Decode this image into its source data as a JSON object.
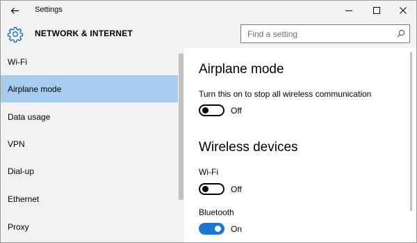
{
  "window": {
    "title": "Settings",
    "controls": [
      "minimize-icon",
      "maximize-icon",
      "close-icon"
    ]
  },
  "header": {
    "section_title": "NETWORK & INTERNET",
    "search_placeholder": "Find a setting",
    "section_icon": "gear-icon",
    "search_icon": "search-icon"
  },
  "sidebar": {
    "items": [
      {
        "label": "Wi-Fi"
      },
      {
        "label": "Airplane mode"
      },
      {
        "label": "Data usage"
      },
      {
        "label": "VPN"
      },
      {
        "label": "Dial-up"
      },
      {
        "label": "Ethernet"
      },
      {
        "label": "Proxy"
      }
    ],
    "active_item": "Airplane mode"
  },
  "main": {
    "airplane": {
      "title": "Airplane mode",
      "description": "Turn this on to stop all wireless communication",
      "state": "Off"
    },
    "wireless": {
      "title": "Wireless devices",
      "wifi_label": "Wi-Fi",
      "wifi_state": "Off",
      "bluetooth_label": "Bluetooth",
      "bluetooth_state": "On"
    }
  },
  "colors": {
    "accent": "#1a78d4",
    "selection": "#a6cdef",
    "chrome": "#f2f2f2"
  }
}
